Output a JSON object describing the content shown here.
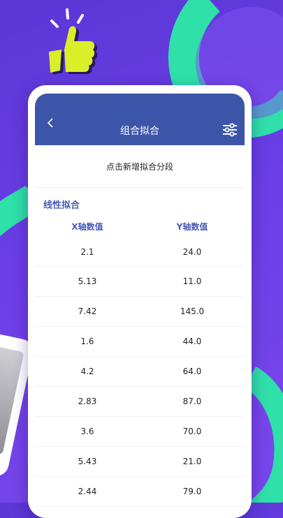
{
  "header": {
    "title": "组合拟合"
  },
  "content": {
    "add_segment_label": "点击新增拟合分段",
    "section_title": "线性拟合",
    "columns": [
      "X轴数值",
      "Y轴数值"
    ],
    "rows": [
      [
        "2.1",
        "24.0"
      ],
      [
        "5.13",
        "11.0"
      ],
      [
        "7.42",
        "145.0"
      ],
      [
        "1.6",
        "44.0"
      ],
      [
        "4.2",
        "64.0"
      ],
      [
        "2.83",
        "87.0"
      ],
      [
        "3.6",
        "70.0"
      ],
      [
        "5.43",
        "21.0"
      ],
      [
        "2.44",
        "79.0"
      ]
    ]
  },
  "colors": {
    "background": "#6b3ee6",
    "accent_ribbon": "#2fe0a8",
    "header": "#3d55a8",
    "label": "#4a5bb8",
    "thumb": "#d9ef2a"
  },
  "icons": {
    "thumb": "thumbs-up-icon",
    "back": "chevron-left-icon",
    "settings": "sliders-icon"
  }
}
